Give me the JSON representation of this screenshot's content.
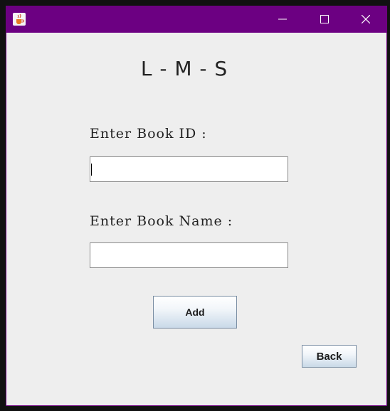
{
  "window": {
    "title": "",
    "titlebar_color": "#6c0082",
    "icons": {
      "app": "java-coffee-icon",
      "minimize": "minimize-icon",
      "maximize": "maximize-icon",
      "close": "close-icon"
    }
  },
  "form": {
    "app_title": "L - M - S",
    "book_id_label": "Enter Book ID :",
    "book_id_value": "",
    "book_name_label": "Enter Book Name :",
    "book_name_value": "",
    "add_label": "Add",
    "back_label": "Back"
  }
}
